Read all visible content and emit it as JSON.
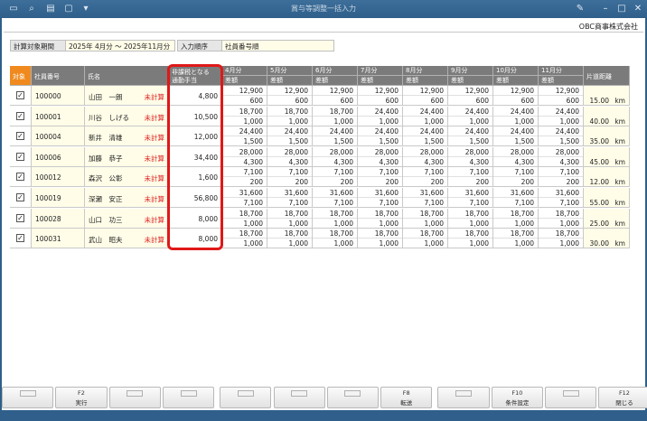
{
  "window": {
    "title": "賞与等調整一括入力"
  },
  "titlebar_icons": [
    "window-icon",
    "search-icon",
    "print-icon",
    "chevron-down-icon"
  ],
  "company": "OBC商事株式会社",
  "conditions": {
    "period_label": "計算対象期間",
    "period_value": "2025年 4月分 〜 2025年11月分",
    "order_label": "入力順序",
    "order_value": "社員番号順"
  },
  "table": {
    "headers": {
      "target": "対象",
      "emp_no": "社員番号",
      "name": "氏名",
      "nontax_line1": "非課税となる",
      "nontax_line2": "通勤手当",
      "distance": "片道距離",
      "diff_label": "差額"
    },
    "months": [
      "4月分",
      "5月分",
      "6月分",
      "7月分",
      "8月分",
      "9月分",
      "10月分",
      "11月分"
    ],
    "status_text": "未計算",
    "unit": "km",
    "rows": [
      {
        "checked": true,
        "emp_no": "100000",
        "name": "山田　一朗",
        "nontax": "4,800",
        "months": [
          [
            "12,900",
            "600"
          ],
          [
            "12,900",
            "600"
          ],
          [
            "12,900",
            "600"
          ],
          [
            "12,900",
            "600"
          ],
          [
            "12,900",
            "600"
          ],
          [
            "12,900",
            "600"
          ],
          [
            "12,900",
            "600"
          ],
          [
            "12,900",
            "600"
          ]
        ],
        "distance": "15.00"
      },
      {
        "checked": true,
        "emp_no": "100001",
        "name": "川谷　しげる",
        "nontax": "10,500",
        "months": [
          [
            "18,700",
            "1,000"
          ],
          [
            "18,700",
            "1,000"
          ],
          [
            "18,700",
            "1,000"
          ],
          [
            "24,400",
            "1,000"
          ],
          [
            "24,400",
            "1,000"
          ],
          [
            "24,400",
            "1,000"
          ],
          [
            "24,400",
            "1,000"
          ],
          [
            "24,400",
            "1,000"
          ]
        ],
        "distance": "40.00"
      },
      {
        "checked": true,
        "emp_no": "100004",
        "name": "新井　清雄",
        "nontax": "12,000",
        "months": [
          [
            "24,400",
            "1,500"
          ],
          [
            "24,400",
            "1,500"
          ],
          [
            "24,400",
            "1,500"
          ],
          [
            "24,400",
            "1,500"
          ],
          [
            "24,400",
            "1,500"
          ],
          [
            "24,400",
            "1,500"
          ],
          [
            "24,400",
            "1,500"
          ],
          [
            "24,400",
            "1,500"
          ]
        ],
        "distance": "35.00"
      },
      {
        "checked": true,
        "emp_no": "100006",
        "name": "加藤　恭子",
        "nontax": "34,400",
        "months": [
          [
            "28,000",
            "4,300"
          ],
          [
            "28,000",
            "4,300"
          ],
          [
            "28,000",
            "4,300"
          ],
          [
            "28,000",
            "4,300"
          ],
          [
            "28,000",
            "4,300"
          ],
          [
            "28,000",
            "4,300"
          ],
          [
            "28,000",
            "4,300"
          ],
          [
            "28,000",
            "4,300"
          ]
        ],
        "distance": "45.00"
      },
      {
        "checked": true,
        "emp_no": "100012",
        "name": "森沢　公彰",
        "nontax": "1,600",
        "months": [
          [
            "7,100",
            "200"
          ],
          [
            "7,100",
            "200"
          ],
          [
            "7,100",
            "200"
          ],
          [
            "7,100",
            "200"
          ],
          [
            "7,100",
            "200"
          ],
          [
            "7,100",
            "200"
          ],
          [
            "7,100",
            "200"
          ],
          [
            "7,100",
            "200"
          ]
        ],
        "distance": "12.00"
      },
      {
        "checked": true,
        "emp_no": "100019",
        "name": "深瀬　安正",
        "nontax": "56,800",
        "months": [
          [
            "31,600",
            "7,100"
          ],
          [
            "31,600",
            "7,100"
          ],
          [
            "31,600",
            "7,100"
          ],
          [
            "31,600",
            "7,100"
          ],
          [
            "31,600",
            "7,100"
          ],
          [
            "31,600",
            "7,100"
          ],
          [
            "31,600",
            "7,100"
          ],
          [
            "31,600",
            "7,100"
          ]
        ],
        "distance": "55.00"
      },
      {
        "checked": true,
        "emp_no": "100028",
        "name": "山口　功三",
        "nontax": "8,000",
        "months": [
          [
            "18,700",
            "1,000"
          ],
          [
            "18,700",
            "1,000"
          ],
          [
            "18,700",
            "1,000"
          ],
          [
            "18,700",
            "1,000"
          ],
          [
            "18,700",
            "1,000"
          ],
          [
            "18,700",
            "1,000"
          ],
          [
            "18,700",
            "1,000"
          ],
          [
            "18,700",
            "1,000"
          ]
        ],
        "distance": "25.00"
      },
      {
        "checked": true,
        "emp_no": "100031",
        "name": "武山　昭夫",
        "nontax": "8,000",
        "months": [
          [
            "18,700",
            "1,000"
          ],
          [
            "18,700",
            "1,000"
          ],
          [
            "18,700",
            "1,000"
          ],
          [
            "18,700",
            "1,000"
          ],
          [
            "18,700",
            "1,000"
          ],
          [
            "18,700",
            "1,000"
          ],
          [
            "18,700",
            "1,000"
          ],
          [
            "18,700",
            "1,000"
          ]
        ],
        "distance": "30.00"
      }
    ]
  },
  "fkeys": [
    {
      "key": "",
      "label": ""
    },
    {
      "key": "F2",
      "label": "実行"
    },
    {
      "key": "",
      "label": ""
    },
    {
      "key": "",
      "label": ""
    },
    {
      "key": "",
      "label": ""
    },
    {
      "key": "",
      "label": ""
    },
    {
      "key": "",
      "label": ""
    },
    {
      "key": "F8",
      "label": "転送"
    },
    {
      "key": "",
      "label": ""
    },
    {
      "key": "F10",
      "label": "条件設定"
    },
    {
      "key": "",
      "label": ""
    },
    {
      "key": "F12",
      "label": "閉じる"
    }
  ]
}
